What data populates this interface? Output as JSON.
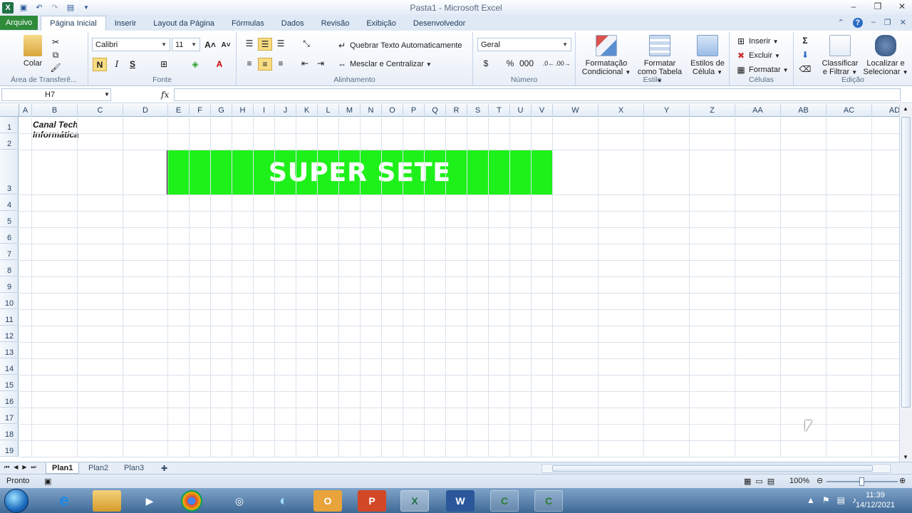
{
  "window": {
    "title": "Pasta1  -  Microsoft Excel"
  },
  "tabs": [
    "Arquivo",
    "Página Inicial",
    "Inserir",
    "Layout da Página",
    "Fórmulas",
    "Dados",
    "Revisão",
    "Exibição",
    "Desenvolvedor"
  ],
  "ribbon": {
    "clipboard": {
      "paste_label": "Colar",
      "group_label": "Área de Transferê..."
    },
    "font": {
      "name": "Calibri",
      "size": "11",
      "bold": "N",
      "italic": "I",
      "underline": "S",
      "group_label": "Fonte"
    },
    "alignment": {
      "wrap_label": "Quebrar Texto Automaticamente",
      "merge_label": "Mesclar e Centralizar",
      "group_label": "Alinhamento"
    },
    "number": {
      "format": "Geral",
      "percent": "%",
      "thousands": "000",
      "group_label": "Número"
    },
    "styles": {
      "conditional_line1": "Formatação",
      "conditional_line2": "Condicional",
      "table_line1": "Formatar",
      "table_line2": "como Tabela",
      "cell_line1": "Estilos de",
      "cell_line2": "Célula",
      "group_label": "Estilo"
    },
    "cells": {
      "insert": "Inserir",
      "delete": "Excluir",
      "format": "Formatar",
      "group_label": "Células"
    },
    "editing": {
      "sort_line1": "Classificar",
      "sort_line2": "e Filtrar",
      "find_line1": "Localizar e",
      "find_line2": "Selecionar",
      "group_label": "Edição"
    }
  },
  "formula_bar": {
    "name_box": "H7",
    "fx": "fx",
    "value": ""
  },
  "columns": [
    "A",
    "B",
    "C",
    "D",
    "E",
    "F",
    "G",
    "H",
    "I",
    "J",
    "K",
    "L",
    "M",
    "N",
    "O",
    "P",
    "Q",
    "R",
    "S",
    "T",
    "U",
    "V",
    "W",
    "X",
    "Y",
    "Z",
    "AA",
    "AB",
    "AC",
    "AD"
  ],
  "rows": [
    "1",
    "2",
    "3",
    "4",
    "5",
    "6",
    "7",
    "8",
    "9",
    "10",
    "11",
    "12",
    "13",
    "14",
    "15",
    "16",
    "17",
    "18",
    "19"
  ],
  "cells": {
    "b1": "Canal Tech Informática",
    "banner": "SUPER SETE"
  },
  "colors": {
    "banner": "#1ef01a",
    "file_tab": "#2e8b3a",
    "ribbon": "#dfe9f5"
  },
  "sheets": [
    "Plan1",
    "Plan2",
    "Plan3"
  ],
  "status": {
    "ready": "Pronto",
    "zoom": "100%"
  },
  "taskbar": {
    "time": "11:39",
    "date": "14/12/2021"
  }
}
